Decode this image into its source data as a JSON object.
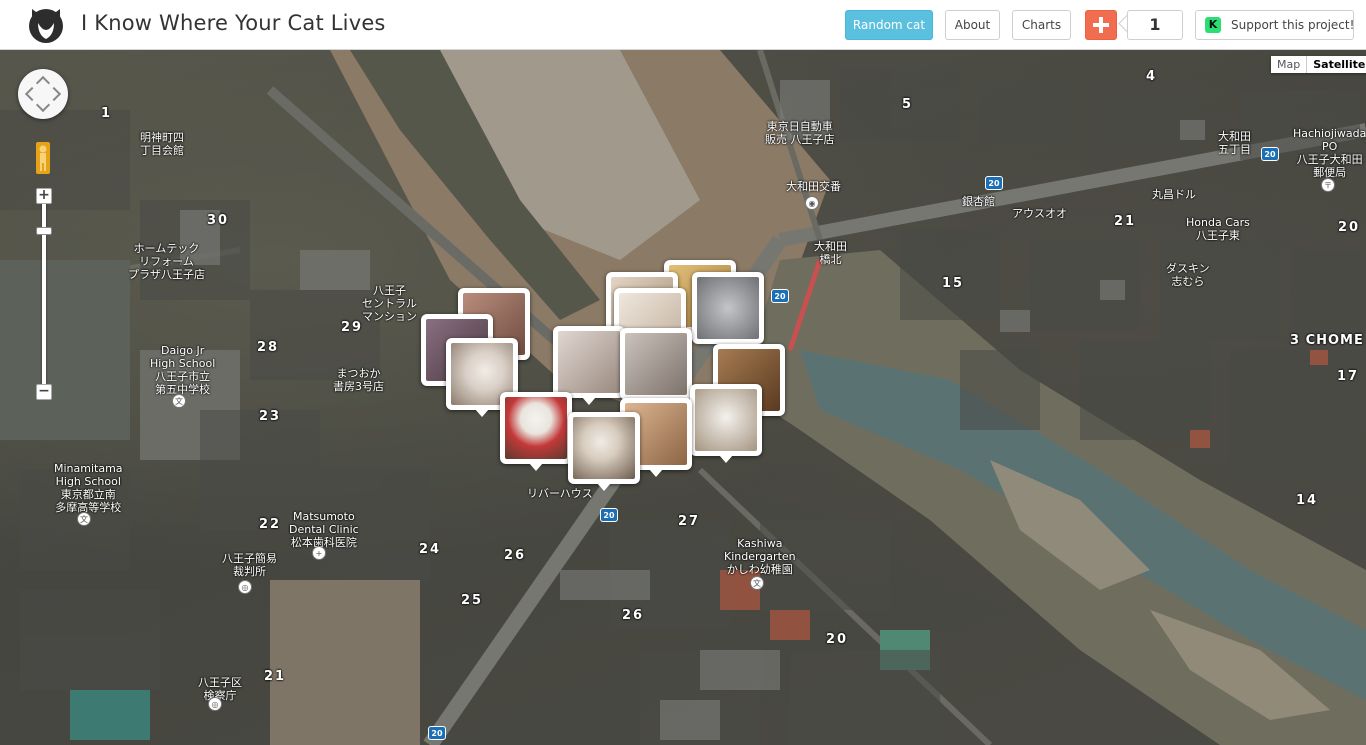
{
  "header": {
    "title": "I Know Where Your Cat Lives",
    "random_cat": "Random cat",
    "about": "About",
    "charts": "Charts",
    "counter": "1",
    "support": "Support this project!",
    "support_icon_text": "K"
  },
  "map": {
    "map_type": {
      "map": "Map",
      "satellite": "Satellite",
      "selected": "Satellite"
    },
    "zoom": {
      "in": "+",
      "out": "−"
    },
    "labels": {
      "meijimachi": "明神町四\n丁目会館",
      "hometech": "ホームテック\nリフォーム\nプラザ八王子店",
      "daigo": "Daigo Jr\nHigh School\n八王子市立\n第五中学校",
      "minamitama": "Minamitama\nHigh School\n東京都立南\n多摩高等学校",
      "matsumoto": "Matsumoto\nDental Clinic\n松本歯科医院",
      "matsuoka": "まつおか\n書房3号店",
      "hachioji_central": "八王子\nセントラル\nマンション",
      "kashiwa": "Kashiwa\nKindergarten\nかしわ幼稚園",
      "honda": "Honda Cars\n八王子東",
      "hachiojiwada_po": "Hachiojiwada\nPO\n八王子大和田\n郵便局",
      "owada_kosaten": "大和田交番",
      "owada_bridge": "大和田\n橋北",
      "ginkyo": "銀杏館",
      "aoyama": "アウスオオ",
      "marukyo": "丸昌ドル",
      "oowada": "大和田\n五丁目",
      "jitensha": "東京日自動車\n販売 八王子店",
      "nanbu": "八王子簡易\n裁判所",
      "kensatsu": "八王子区\n検察庁",
      "hachi_chome": "3 CHOME",
      "riverhouse": "リバーハウス",
      "dasukin": "ダスキン\n志むら"
    },
    "blocks": [
      "30",
      "29",
      "28",
      "23",
      "22",
      "24",
      "25",
      "26",
      "27",
      "26",
      "20",
      "21",
      "15",
      "14",
      "17",
      "20",
      "21",
      "4",
      "5",
      "1"
    ],
    "route_shields": [
      "20",
      "20",
      "20",
      "20",
      "20"
    ]
  },
  "cats": [
    {
      "name": "cat-marker-1",
      "color": "#b98d7d"
    },
    {
      "name": "cat-marker-2",
      "color": "#8a6f80"
    },
    {
      "name": "cat-marker-3",
      "color": "#d9cfc6"
    },
    {
      "name": "cat-marker-4",
      "color": "#c7a56a"
    },
    {
      "name": "cat-marker-5",
      "color": "#9fa1a4"
    },
    {
      "name": "cat-marker-6",
      "color": "#d6c4b0"
    },
    {
      "name": "cat-marker-7",
      "color": "#e4d8cc"
    },
    {
      "name": "cat-marker-8",
      "color": "#7f5b3a"
    },
    {
      "name": "cat-marker-9",
      "color": "#cfc3bd"
    },
    {
      "name": "cat-marker-10",
      "color": "#b4aaa3"
    },
    {
      "name": "cat-marker-11",
      "color": "#c23939"
    },
    {
      "name": "cat-marker-12",
      "color": "#d8c9b9"
    },
    {
      "name": "cat-marker-13",
      "color": "#c99b75"
    },
    {
      "name": "cat-marker-14",
      "color": "#b53a3a"
    }
  ]
}
